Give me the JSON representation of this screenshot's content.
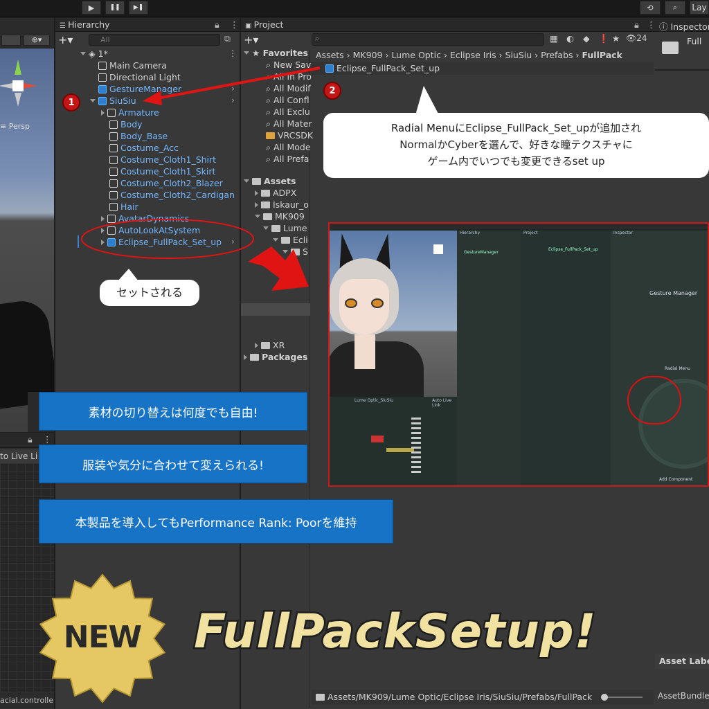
{
  "toolbar": {
    "play": "▶",
    "pause": "❚❚",
    "step": "▶❚",
    "layout": "Lay"
  },
  "scene": {
    "persp_label": "≡ Persp"
  },
  "animator": {
    "live_link": "to Live Li",
    "controller": "acial.controller"
  },
  "hierarchy": {
    "tab": "Hierarchy",
    "search_placeholder": "All",
    "scene_name": "1*",
    "items": [
      {
        "label": "Main Camera"
      },
      {
        "label": "Directional Light"
      },
      {
        "label": "GestureManager"
      },
      {
        "label": "SiuSiu"
      },
      {
        "label": "Armature"
      },
      {
        "label": "Body"
      },
      {
        "label": "Body_Base"
      },
      {
        "label": "Costume_Acc"
      },
      {
        "label": "Costume_Cloth1_Shirt"
      },
      {
        "label": "Costume_Cloth1_Skirt"
      },
      {
        "label": "Costume_Cloth2_Blazer"
      },
      {
        "label": "Costume_Cloth2_Cardigan"
      },
      {
        "label": "Hair"
      },
      {
        "label": "AvatarDynamics"
      },
      {
        "label": "AutoLookAtSystem"
      },
      {
        "label": "Eclipse_FullPack_Set_up"
      }
    ]
  },
  "project": {
    "tab": "Project",
    "badge_count": "24",
    "favorites_header": "Favorites",
    "favorites": [
      "New Sav",
      "All In Pro",
      "All Modif",
      "All Confl",
      "All Exclu",
      "All Mater",
      "VRCSDK",
      "All Mode",
      "All Prefa"
    ],
    "assets_header": "Assets",
    "assets_tree": [
      "ADPX",
      "Iskaur_o",
      "MK909",
      "Lume",
      "Ecli",
      "S"
    ],
    "bottom_tree": [
      "XR",
      "Packages"
    ],
    "breadcrumb": [
      "Assets",
      "MK909",
      "Lume Optic",
      "Eclipse Iris",
      "SiuSiu",
      "Prefabs",
      "FullPack"
    ],
    "selected_asset": "Eclipse_FullPack_Set_up",
    "status_path": "Assets/MK909/Lume Optic/Eclipse Iris/SiuSiu/Prefabs/FullPack"
  },
  "inspector": {
    "tab": "Inspector",
    "full_label": "Full",
    "asset_labels": "Asset Labe",
    "asset_bundle": "AssetBundle"
  },
  "annotations": {
    "step1": "1",
    "step2": "2",
    "callout_set": "セットされる",
    "callout_radial_line1": "Radial MenuにEclipse_FullPack_Set_upが追加され",
    "callout_radial_line2": "NormalかCyberを選んで、好きな瞳テクスチャに",
    "callout_radial_line3": "ゲーム内でいつでも変更できるset up",
    "feature1": "素材の切り替えは何度でも自由!",
    "feature2": "服装や気分に合わせて変えられる!",
    "feature3": "本製品を導入してもPerformance Rank: Poorを維持",
    "new_badge": "NEW",
    "headline": "FullPackSetup!"
  },
  "mini_screenshot": {
    "hierarchy_tab": "Hierarchy",
    "project_tab": "Project",
    "inspector_tab": "Inspector",
    "gesture_manager": "GestureManager",
    "gesture_manager_title": "Gesture Manager",
    "radial_menu": "Radial Menu",
    "add_component": "Add Component",
    "lume_label": "Lume Optic_SiuSiu",
    "auto_live_link": "Auto Live Link",
    "eclipse_item": "Eclipse_FullPack_Set_up"
  },
  "colors": {
    "accent_red": "#d01818",
    "feature_blue": "#1773c6",
    "headline_gold": "#f2e2a2"
  }
}
